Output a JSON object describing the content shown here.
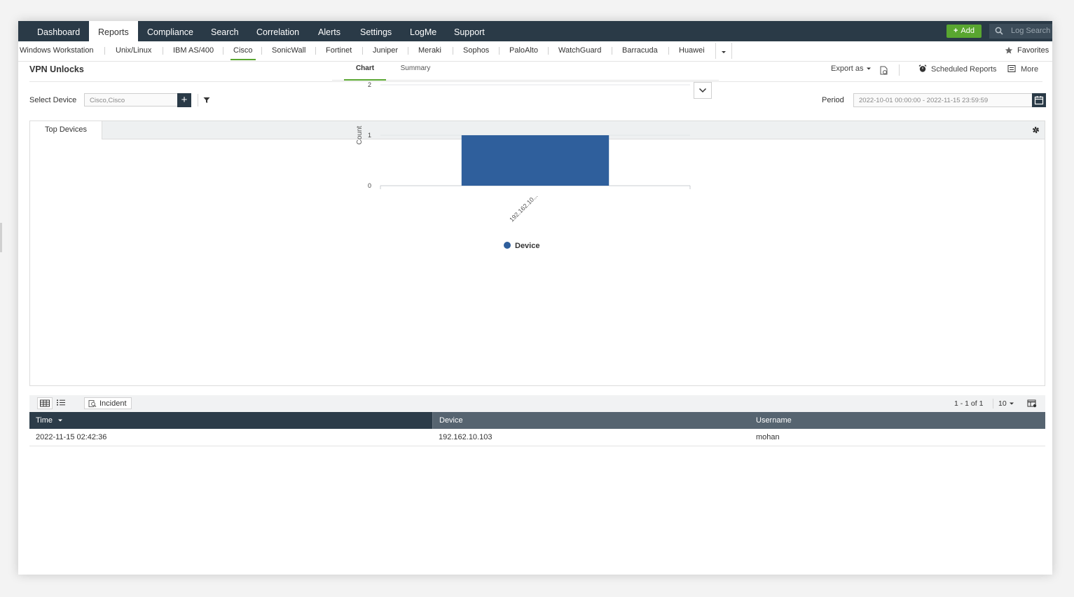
{
  "topnav": {
    "tabs": [
      "Dashboard",
      "Reports",
      "Compliance",
      "Search",
      "Correlation",
      "Alerts",
      "Settings",
      "LogMe",
      "Support"
    ],
    "active": "Reports",
    "add_label": "Add",
    "log_search_label": "Log Search"
  },
  "subnav": {
    "items": [
      "Windows Workstation",
      "Unix/Linux",
      "IBM AS/400",
      "Cisco",
      "SonicWall",
      "Fortinet",
      "Juniper",
      "Meraki",
      "Sophos",
      "PaloAlto",
      "WatchGuard",
      "Barracuda",
      "Huawei"
    ],
    "active": "Cisco",
    "favorites_label": "Favorites"
  },
  "report": {
    "title": "VPN Unlocks",
    "export_label": "Export as",
    "scheduled_label": "Scheduled Reports",
    "more_label": "More"
  },
  "filters": {
    "select_device_label": "Select Device",
    "device_value": "Cisco,Cisco",
    "period_label": "Period",
    "period_value": "2022-10-01 00:00:00 - 2022-11-15 23:59:59"
  },
  "widget": {
    "tab_label": "Top Devices",
    "chart_tab": "Chart",
    "summary_tab": "Summary"
  },
  "chart_data": {
    "type": "bar",
    "categories": [
      "192.162.10..."
    ],
    "series": [
      {
        "name": "Device",
        "values": [
          1
        ]
      }
    ],
    "ylabel": "Count",
    "xlabel": "",
    "ylim": [
      0,
      2
    ],
    "yticks": [
      "0",
      "1",
      "2"
    ],
    "grid": true,
    "legend": "bottom",
    "color": "#2f5f9c"
  },
  "table": {
    "incident_label": "Incident",
    "pager": "1 - 1 of 1",
    "per_page": "10",
    "columns": [
      "Time",
      "Device",
      "Username"
    ],
    "rows": [
      [
        "2022-11-15 02:42:36",
        "192.162.10.103",
        "mohan"
      ]
    ]
  },
  "colors": {
    "nav_bg": "#2a3a47",
    "accent": "#59a630",
    "bar": "#2f5f9c"
  }
}
